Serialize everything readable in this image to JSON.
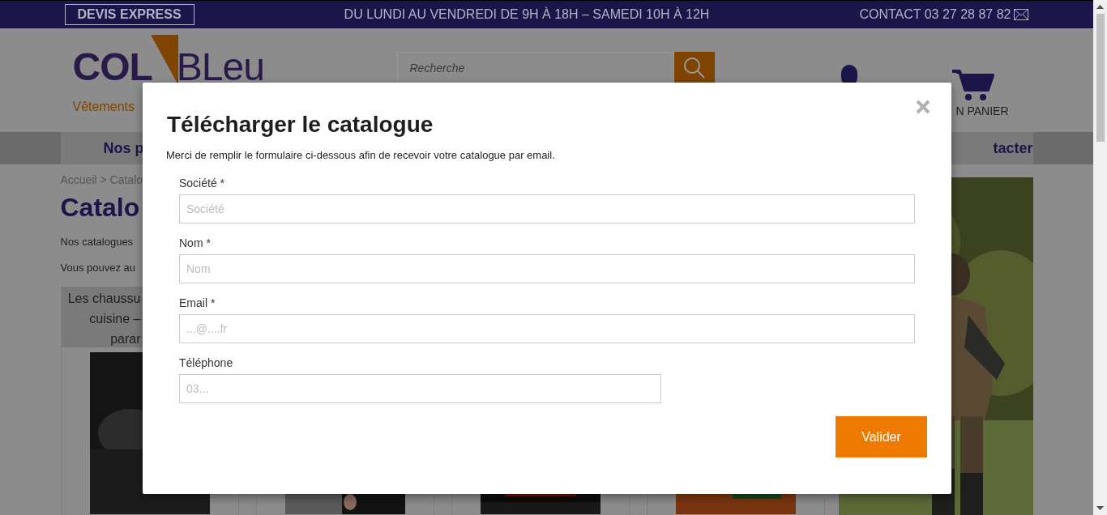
{
  "top_bar": {
    "quote_button": "DEVIS EXPRESS",
    "hours": "DU LUNDI AU VENDREDI DE 9H À 18H – SAMEDI 10H À 12H",
    "contact": "CONTACT 03 27 28 87 82"
  },
  "header": {
    "logo_left": "COL",
    "logo_right": "BLeu",
    "tagline": "Vêtements",
    "search": {
      "placeholder": "Recherche"
    },
    "cart_label": "N PANIER"
  },
  "nav": [
    "Nos p",
    "tacter"
  ],
  "page": {
    "breadcrumb": "Accueil > Catalo",
    "title": "Catalo",
    "paragraphs": [
      "Nos catalogues",
      "Vous pouvez au"
    ],
    "cards": [
      {
        "kind": "picture",
        "caption_lines": [
          "Les chaussu",
          "cuisine –",
          "parar"
        ]
      },
      {
        "kind": "picture"
      },
      {
        "kind": "picture"
      },
      {
        "kind": "picture"
      }
    ]
  },
  "modal": {
    "title": "Télécharger le catalogue",
    "intro": "Merci de remplir le formulaire ci-dessous afin de recevoir votre catalogue par email.",
    "fields": [
      {
        "label": "Société *",
        "placeholder": "Société",
        "kind": "wide"
      },
      {
        "label": "Nom *",
        "placeholder": "Nom",
        "kind": "wide"
      },
      {
        "label": "Email *",
        "placeholder": "...@....fr",
        "kind": "wide"
      },
      {
        "label": "Téléphone",
        "placeholder": "03...",
        "kind": "short"
      }
    ],
    "submit": "Valider"
  }
}
